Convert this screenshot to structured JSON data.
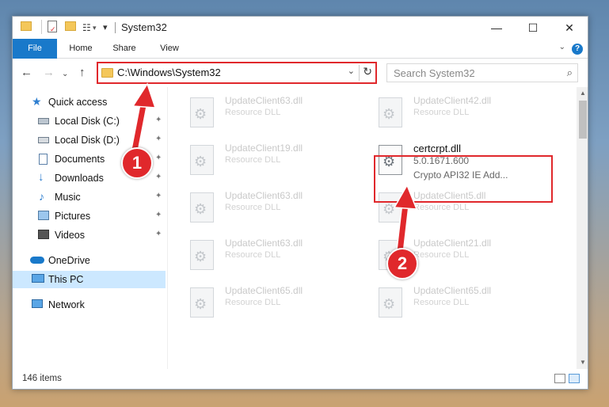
{
  "window": {
    "title": "System32",
    "controls": {
      "minimize": "—",
      "maximize": "☐",
      "close": "✕"
    }
  },
  "quick_access_toolbar": {
    "dropdown": "▾"
  },
  "ribbon": {
    "tabs": [
      "File",
      "Home",
      "Share",
      "View"
    ],
    "expand": "⌄",
    "help": "?"
  },
  "nav": {
    "back": "←",
    "forward": "→",
    "recent": "⌄",
    "up": "↑",
    "address": "C:\\Windows\\System32",
    "address_dropdown": "⌄",
    "refresh": "↻",
    "search_placeholder": "Search System32",
    "search_icon": "⌕"
  },
  "sidebar": {
    "items": [
      {
        "label": "Quick access",
        "icon": "star-icon",
        "pinned": false
      },
      {
        "label": "Local Disk (C:)",
        "icon": "drive-icon",
        "pinned": true
      },
      {
        "label": "Local Disk (D:)",
        "icon": "drive-icon",
        "pinned": true
      },
      {
        "label": "Documents",
        "icon": "documents-icon",
        "pinned": true
      },
      {
        "label": "Downloads",
        "icon": "downloads-icon",
        "pinned": true
      },
      {
        "label": "Music",
        "icon": "music-icon",
        "pinned": true
      },
      {
        "label": "Pictures",
        "icon": "pictures-icon",
        "pinned": true
      },
      {
        "label": "Videos",
        "icon": "videos-icon",
        "pinned": true
      },
      {
        "label": "OneDrive",
        "icon": "cloud-icon",
        "pinned": false
      },
      {
        "label": "This PC",
        "icon": "computer-icon",
        "pinned": false,
        "selected": true
      },
      {
        "label": "Network",
        "icon": "network-icon",
        "pinned": false
      }
    ],
    "pin_glyph": "📌"
  },
  "files": {
    "left_column": [
      {
        "name": "UpdateClient63.dll",
        "type": "Resource DLL"
      },
      {
        "name": "UpdateClient19.dll",
        "type": "Resource DLL"
      },
      {
        "name": "UpdateClient63.dll",
        "type": "Resource DLL"
      },
      {
        "name": "UpdateClient63.dll",
        "type": "Resource DLL"
      },
      {
        "name": "UpdateClient65.dll",
        "type": "Resource DLL"
      }
    ],
    "right_column": [
      {
        "name": "UpdateClient42.dll",
        "type": "Resource DLL"
      },
      {
        "name": "certcrpt.dll",
        "type": "5.0.1671.600",
        "desc": "Crypto API32 IE Add...",
        "highlighted": true
      },
      {
        "name": "UpdateClient5.dll",
        "type": "Resource DLL"
      },
      {
        "name": "UpdateClient21.dll",
        "type": "Resource DLL"
      },
      {
        "name": "UpdateClient65.dll",
        "type": "Resource DLL"
      }
    ]
  },
  "status": {
    "item_count": "146 items"
  },
  "annotations": {
    "step1": "1",
    "step2": "2"
  },
  "colors": {
    "accent": "#1979ca",
    "annotation_red": "#e0282c",
    "selection": "#cce8ff"
  }
}
